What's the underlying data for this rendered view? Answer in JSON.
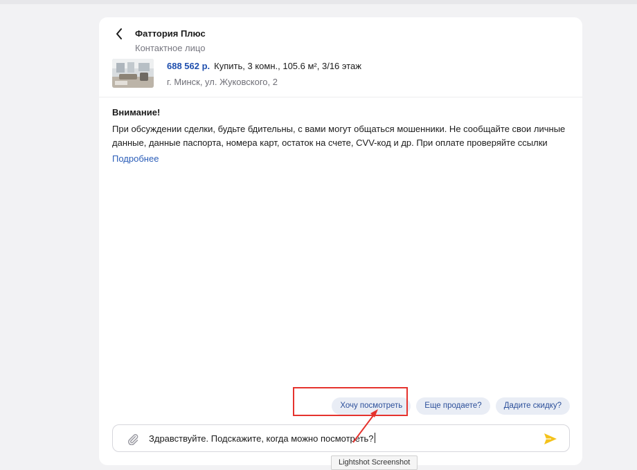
{
  "header": {
    "contact_name": "Фаттория Плюс",
    "contact_role": "Контактное лицо",
    "back_icon": "chevron-left-icon"
  },
  "listing": {
    "price": "688 562 р.",
    "summary": "Купить, 3 комн., 105.6 м², 3/16 этаж",
    "address": "г. Минск, ул. Жуковского, 2",
    "thumbnail": "apartment-photo"
  },
  "warning": {
    "title": "Внимание!",
    "text": "При обсуждении сделки, будьте бдительны, с вами могут общаться мошенники. Не сообщайте свои личные данные, данные паспорта, номера карт, остаток на счете, CVV-код и др. При оплате проверяйте ссылки",
    "link": "Подробнее"
  },
  "quick_replies": [
    "Хочу посмотреть",
    "Еще продаете?",
    "Дадите скидку?"
  ],
  "message": {
    "value": "Здравствуйте. Подскажите, когда можно посмотреть?",
    "attach_icon": "paperclip-icon",
    "send_icon": "send-icon"
  },
  "tooltip": {
    "text": "Lightshot Screenshot"
  },
  "colors": {
    "accent": "#2a5db8",
    "price": "#1f4fae",
    "send": "#f4c21b",
    "annotation": "#e5322d",
    "chip_bg": "#e9edf5"
  }
}
